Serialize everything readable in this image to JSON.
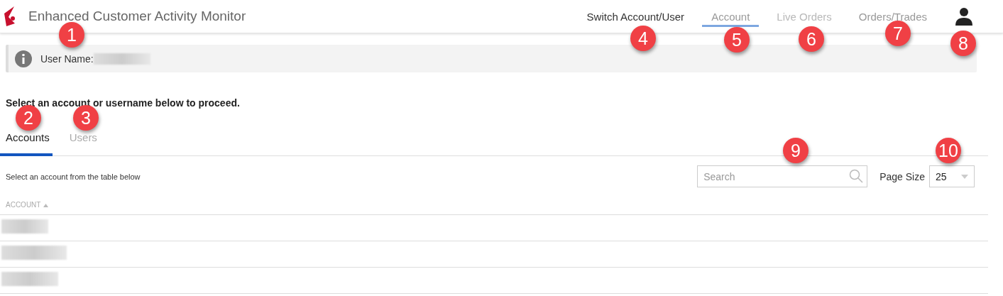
{
  "app": {
    "title": "Enhanced Customer Activity Monitor"
  },
  "nav": [
    {
      "label": "Switch Account/User",
      "kind": "action",
      "selected": false,
      "disabled": false
    },
    {
      "label": "Account",
      "kind": "tab",
      "selected": true,
      "disabled": false
    },
    {
      "label": "Live Orders",
      "kind": "tab",
      "selected": false,
      "disabled": true
    },
    {
      "label": "Orders/Trades",
      "kind": "tab",
      "selected": false,
      "disabled": false
    }
  ],
  "info": {
    "label": "User Name:",
    "value_redacted": true
  },
  "prompt": "Select an account or username below to proceed.",
  "tabs": [
    {
      "label": "Accounts",
      "selected": true
    },
    {
      "label": "Users",
      "selected": false
    }
  ],
  "hint": "Select an account from the table below",
  "search": {
    "placeholder": "Search"
  },
  "page_size": {
    "label": "Page Size",
    "value": "25"
  },
  "table": {
    "columns": [
      {
        "label": "ACCOUNT",
        "sort_ascending": true
      }
    ],
    "rows": [
      {
        "kind": "redacted"
      },
      {
        "kind": "redacted"
      },
      {
        "kind": "redacted"
      }
    ]
  },
  "callouts": [
    "1",
    "2",
    "3",
    "4",
    "5",
    "6",
    "7",
    "8",
    "9",
    "10"
  ]
}
